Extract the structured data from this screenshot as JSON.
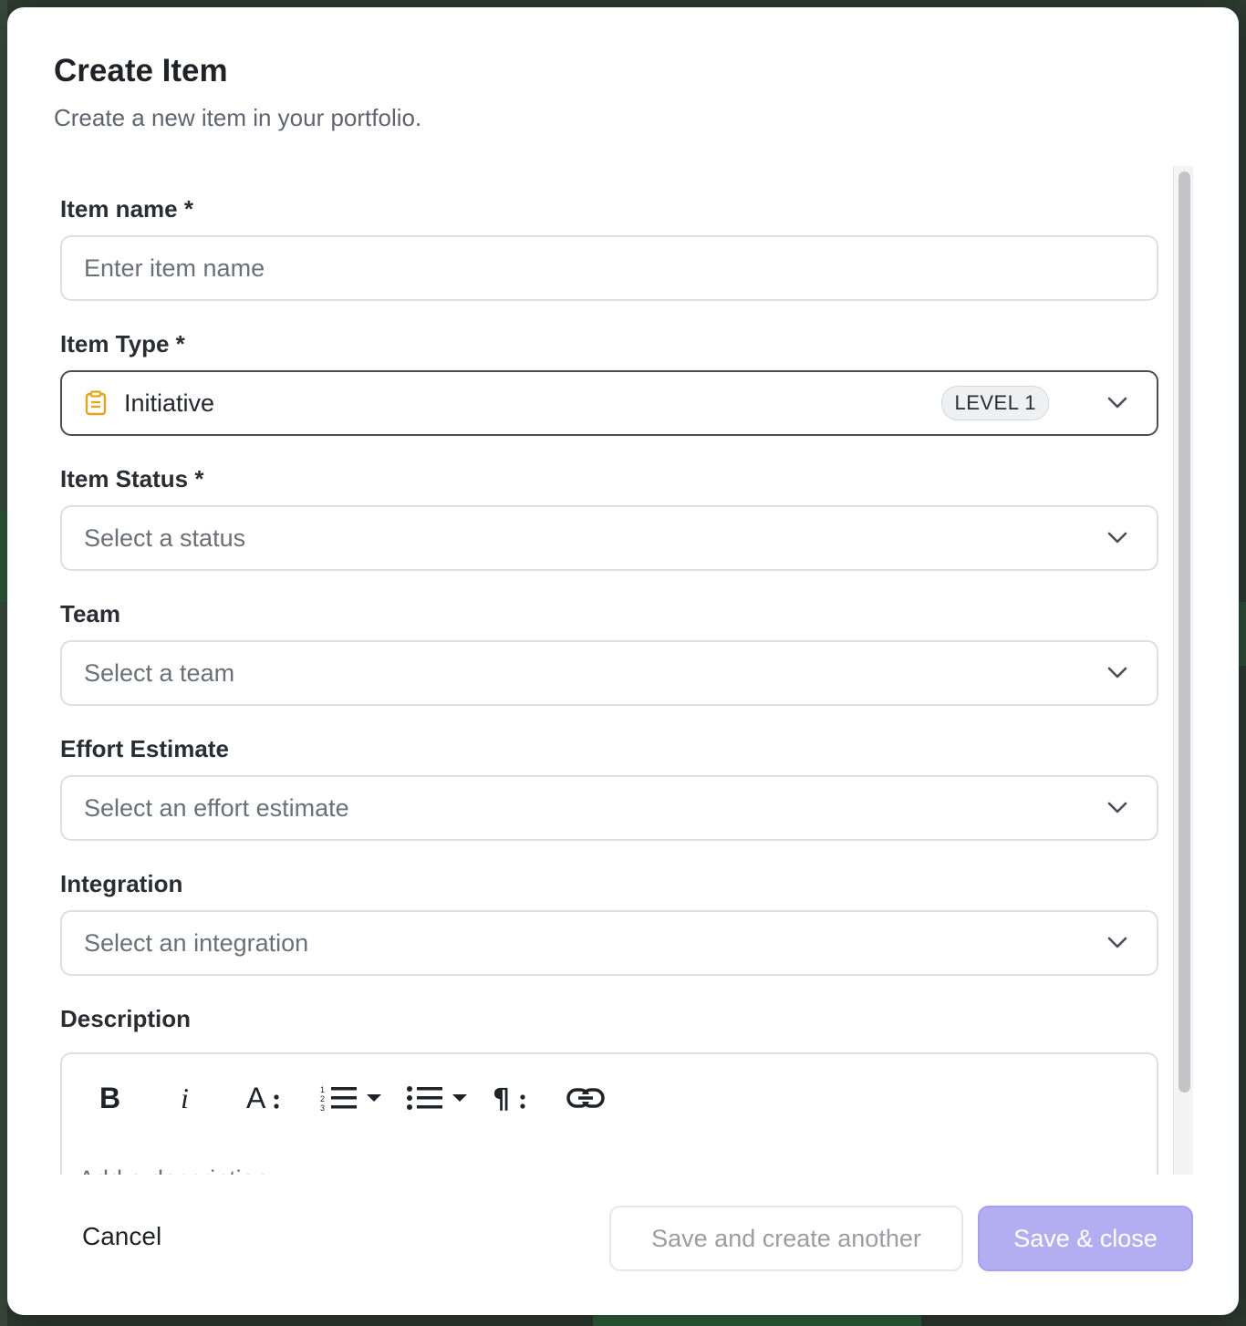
{
  "dialog": {
    "title": "Create Item",
    "subtitle": "Create a new item in your portfolio."
  },
  "fields": {
    "item_name": {
      "label": "Item name *",
      "placeholder": "Enter item name",
      "value": ""
    },
    "item_type": {
      "label": "Item Type *",
      "value": "Initiative",
      "badge": "LEVEL 1",
      "icon": "clipboard-icon",
      "icon_color": "#e8a317"
    },
    "item_status": {
      "label": "Item Status *",
      "placeholder": "Select a status"
    },
    "team": {
      "label": "Team",
      "placeholder": "Select a team"
    },
    "effort_estimate": {
      "label": "Effort Estimate",
      "placeholder": "Select an effort estimate"
    },
    "integration": {
      "label": "Integration",
      "placeholder": "Select an integration"
    },
    "description": {
      "label": "Description",
      "placeholder": "Add a description",
      "toolbar": [
        "bold-icon",
        "italic-icon",
        "font-size-icon",
        "ordered-list-icon",
        "bullet-list-icon",
        "paragraph-icon",
        "link-icon"
      ]
    }
  },
  "footer": {
    "cancel_label": "Cancel",
    "save_another_label": "Save and create another",
    "save_close_label": "Save & close"
  },
  "colors": {
    "primary_disabled": "#b3aef2",
    "focus_border": "#4a4d55"
  }
}
